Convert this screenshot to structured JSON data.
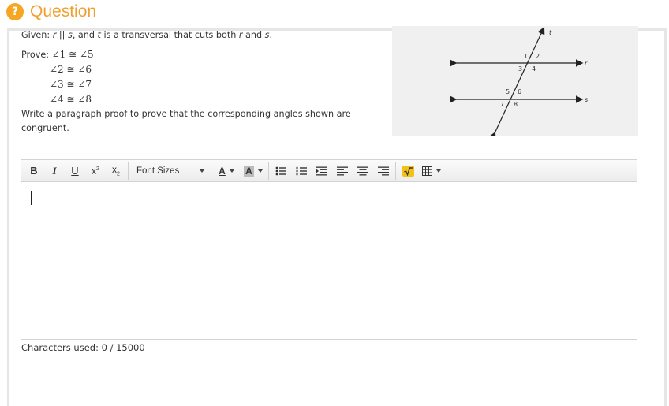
{
  "header": {
    "icon_glyph": "?",
    "title": "Question"
  },
  "prompt": {
    "given_prefix": "Given: ",
    "given_r": "r",
    "given_parallel": " || ",
    "given_s": "s",
    "given_mid": ", and ",
    "given_t": "t",
    "given_mid2": " is a transversal that cuts both ",
    "given_r2": "r",
    "given_and": " and ",
    "given_s2": "s",
    "given_end": ".",
    "prove_label": "Prove: ",
    "statements": [
      "∠1 ≅ ∠5",
      "∠2 ≅ ∠6",
      "∠3 ≅ ∠7",
      "∠4 ≅ ∠8"
    ],
    "instruction": "Write a paragraph proof to prove that the corresponding angles shown are congruent."
  },
  "figure": {
    "line_labels": {
      "t": "t",
      "r": "r",
      "s": "s"
    },
    "angle_labels": [
      "1",
      "2",
      "3",
      "4",
      "5",
      "6",
      "7",
      "8"
    ]
  },
  "toolbar": {
    "bold": "B",
    "italic": "I",
    "underline": "U",
    "font_sizes_label": "Font Sizes",
    "font_color": "A",
    "highlight_color": "A"
  },
  "editor": {
    "value": ""
  },
  "footer": {
    "char_count": "Characters used: 0 / 15000"
  }
}
